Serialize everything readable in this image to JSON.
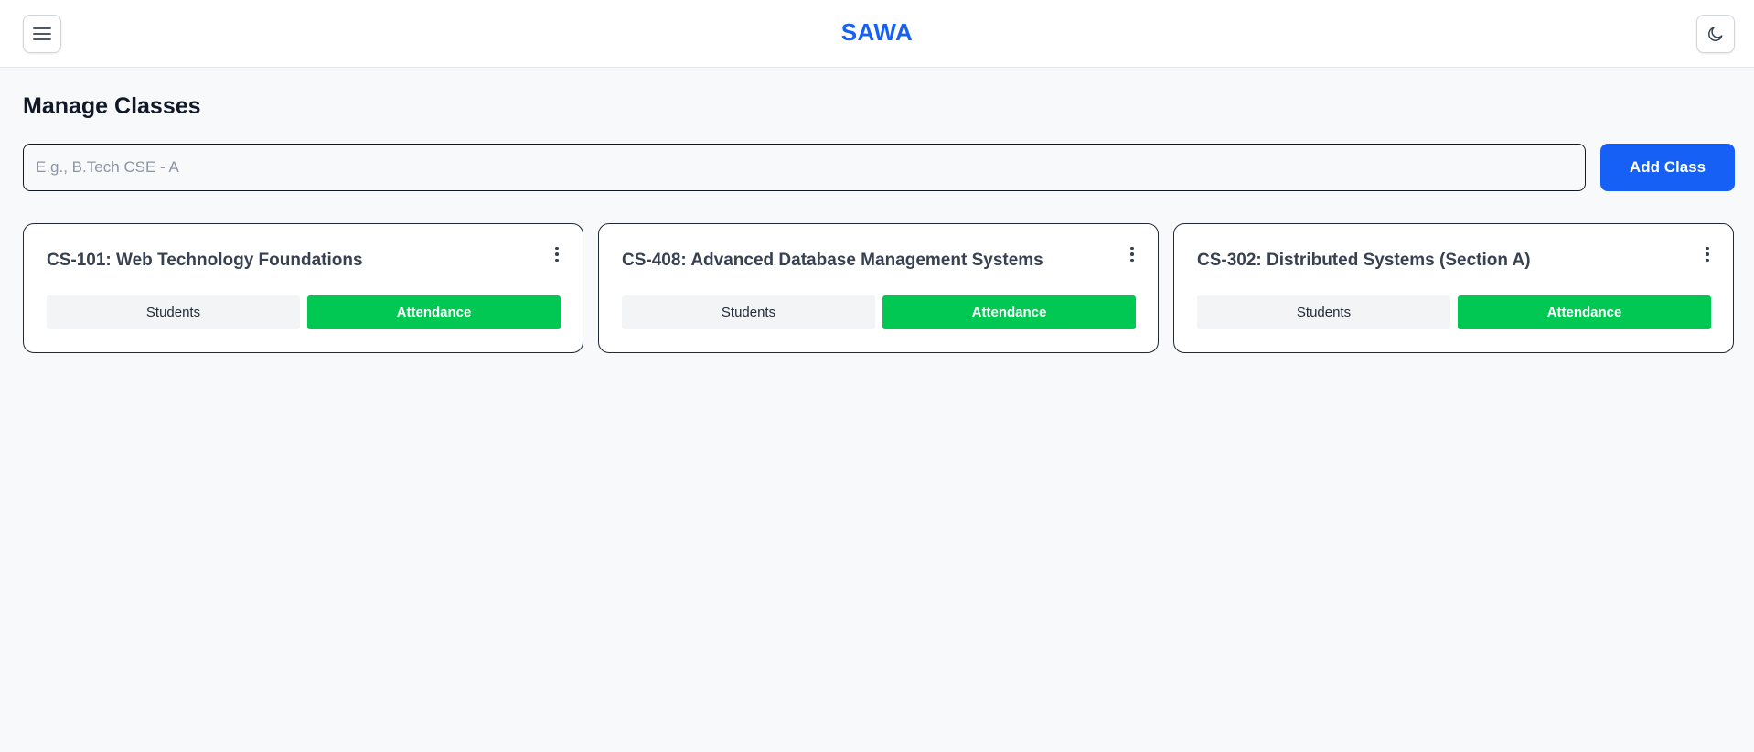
{
  "header": {
    "brand": "SAWA",
    "menu_icon": "hamburger-menu-icon",
    "theme_icon": "moon-icon"
  },
  "main": {
    "title": "Manage Classes",
    "input_placeholder": "E.g., B.Tech CSE - A",
    "input_value": "",
    "add_label": "Add Class"
  },
  "classes": [
    {
      "title": "CS-101: Web Technology Foundations",
      "students_label": "Students",
      "attendance_label": "Attendance"
    },
    {
      "title": "CS-408: Advanced Database Management Systems",
      "students_label": "Students",
      "attendance_label": "Attendance"
    },
    {
      "title": "CS-302: Distributed Systems (Section A)",
      "students_label": "Students",
      "attendance_label": "Attendance"
    }
  ],
  "colors": {
    "brand": "#1660f5",
    "primary_button": "#1660f5",
    "attendance_button": "#00c853",
    "background": "#f8f9fb"
  }
}
